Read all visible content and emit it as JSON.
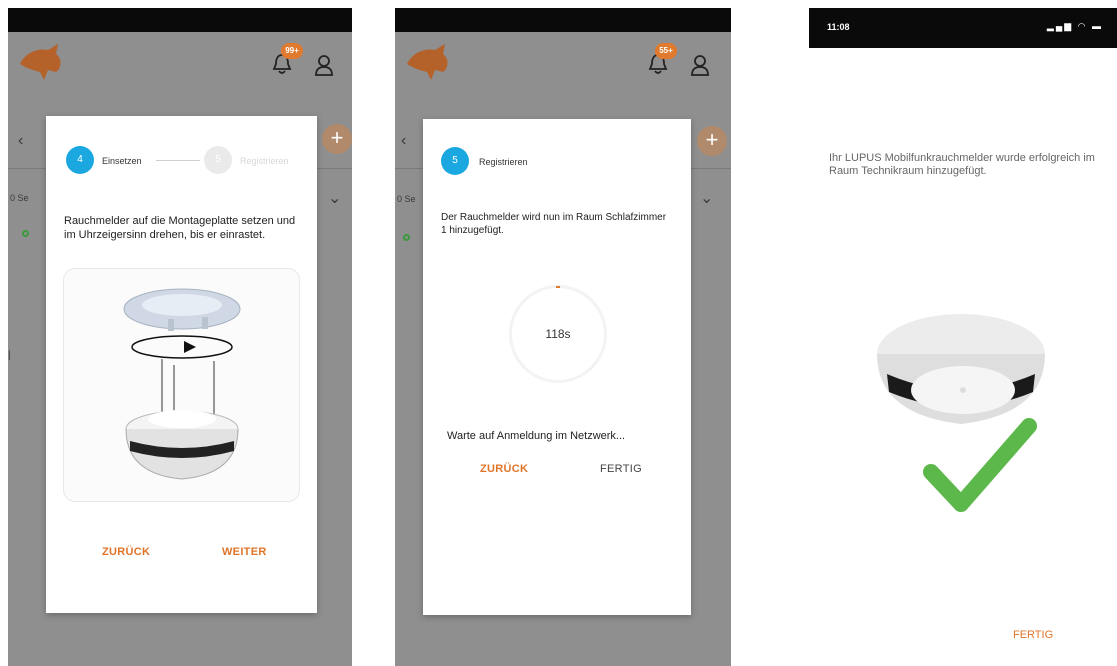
{
  "screen1": {
    "badge": "99+",
    "bg_partial_label": "0 Se",
    "step_current": {
      "number": "4",
      "label": "Einsetzen"
    },
    "step_next": {
      "number": "5",
      "label": "Registrieren"
    },
    "instruction": "Rauchmelder auf die Montageplatte setzen und im Uhrzeigersinn drehen, bis er einrastet.",
    "back_label": "ZURÜCK",
    "next_label": "WEITER"
  },
  "screen2": {
    "badge": "55+",
    "bg_partial_label": "0 Se",
    "step_current": {
      "number": "5",
      "label": "Registrieren"
    },
    "instruction": "Der Rauchmelder wird nun im Raum Schlafzimmer 1 hinzugefügt.",
    "timer_value": "118s",
    "waiting_text": "Warte auf Anmeldung im Netzwerk...",
    "back_label": "ZURÜCK",
    "done_label": "FERTIG"
  },
  "screen3": {
    "status_time": "11:08",
    "status_icons": "▂▄▆ ◠ ▬",
    "message": "Ihr LUPUS Mobilfunkrauchmelder wurde erfolgreich im Raum Technikraum hinzugefügt.",
    "done_label": "FERTIG"
  },
  "colors": {
    "accent_orange": "#e0752a",
    "step_blue": "#1ba7df",
    "success_green": "#5cb84a",
    "overlay_grey": "#8f8f8f"
  },
  "icons": [
    "fox-logo-icon",
    "bell-icon",
    "user-icon",
    "chevron-left-icon",
    "chevron-down-icon",
    "plus-icon",
    "smoke-detector-image",
    "checkmark-icon"
  ]
}
